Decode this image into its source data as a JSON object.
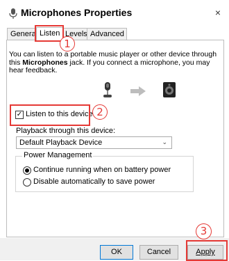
{
  "window": {
    "title": "Microphones Properties",
    "close_glyph": "×",
    "icon": "microphone-icon"
  },
  "tabs": [
    {
      "label": "General",
      "active": false
    },
    {
      "label": "Listen",
      "active": true
    },
    {
      "label": "Levels",
      "active": false
    },
    {
      "label": "Advanced",
      "active": false
    }
  ],
  "listen": {
    "description_part1": "You can listen to a portable music player or other device through this ",
    "description_bold": "Microphones",
    "description_part2": " jack.  If you connect a microphone, you may hear feedback.",
    "images": {
      "source": "microphone-icon",
      "arrow": "arrow-right-icon",
      "target": "speaker-icon"
    },
    "checkbox_label": "Listen to this device",
    "checkbox_checked": true,
    "playback_label": "Playback through this device:",
    "playback_value": "Default Playback Device",
    "power_group": "Power Management",
    "radio_options": [
      {
        "label": "Continue running when on battery power",
        "selected": true
      },
      {
        "label": "Disable automatically to save power",
        "selected": false
      }
    ]
  },
  "buttons": {
    "ok": "OK",
    "cancel": "Cancel",
    "apply": "Apply"
  },
  "annotations": {
    "one": "1",
    "two": "2",
    "three": "3"
  },
  "colors": {
    "annotation": "#e53935",
    "primary_border": "#0078d7"
  }
}
